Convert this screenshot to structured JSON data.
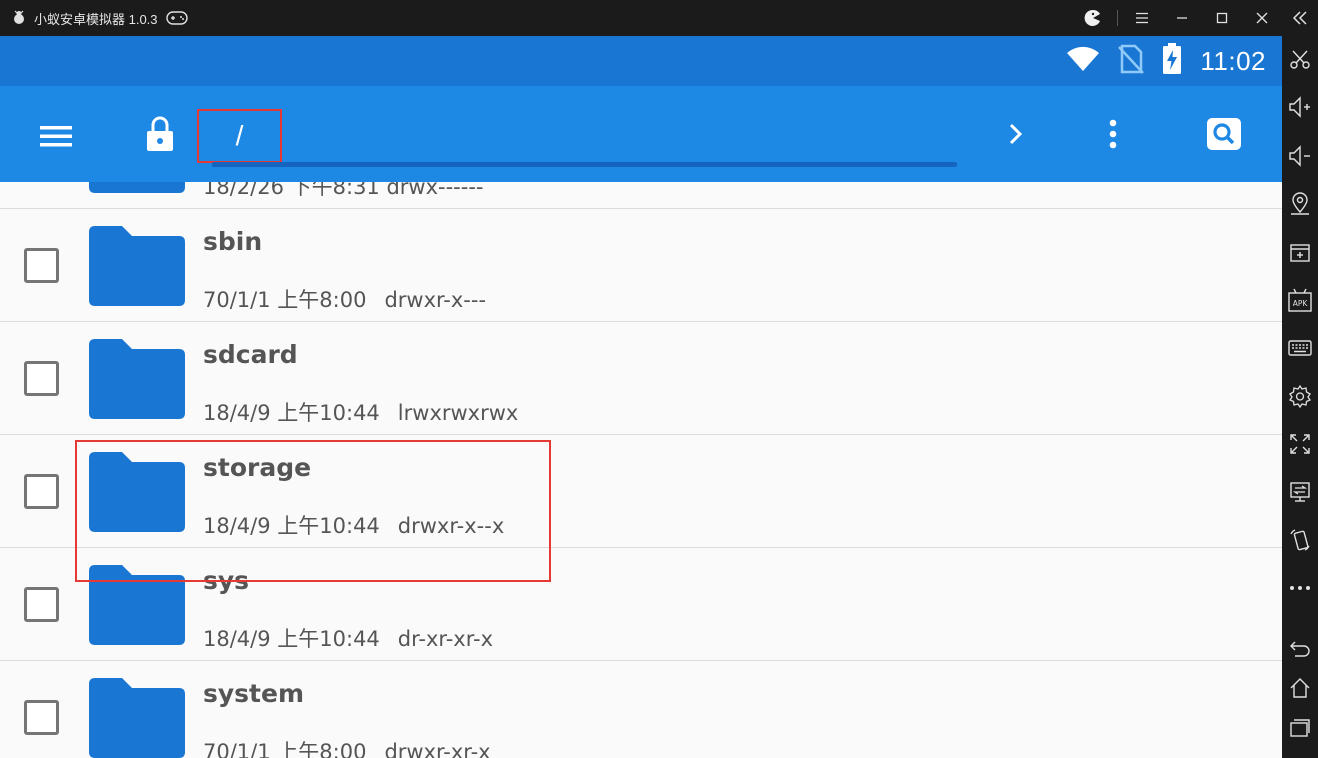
{
  "window": {
    "title": "小蚁安卓模拟器 1.0.3",
    "logo_icon": "ant-logo-icon",
    "gamepad_icon": "gamepad-icon",
    "controls": [
      "pacman-icon",
      "menu-icon",
      "minimize-icon",
      "maximize-icon",
      "close-icon"
    ]
  },
  "status_bar": {
    "time": "11:02",
    "icons": [
      "wifi-icon",
      "no-sim-icon",
      "battery-charging-icon"
    ]
  },
  "app_bar": {
    "path": "/",
    "icons": [
      "hamburger-menu-icon",
      "lock-icon",
      "chevron-right-icon",
      "more-vert-icon",
      "search-icon"
    ]
  },
  "partial_row": {
    "meta": "18/2/26 下午8:31   drwx------"
  },
  "files": [
    {
      "name": "sbin",
      "date": "70/1/1 上午8:00",
      "perm": "drwxr-x---"
    },
    {
      "name": "sdcard",
      "date": "18/4/9 上午10:44",
      "perm": "lrwxrwxrwx"
    },
    {
      "name": "storage",
      "date": "18/4/9 上午10:44",
      "perm": "drwxr-x--x"
    },
    {
      "name": "sys",
      "date": "18/4/9 上午10:44",
      "perm": "dr-xr-xr-x"
    },
    {
      "name": "system",
      "date": "70/1/1 上午8:00",
      "perm": "drwxr-xr-x"
    }
  ],
  "sidebar": {
    "icons": [
      "collapse-icon",
      "scissors-icon",
      "volume-up-icon",
      "volume-down-icon",
      "location-icon",
      "add-window-icon",
      "apk-icon",
      "keyboard-icon",
      "settings-icon",
      "fullscreen-icon",
      "screen-share-icon",
      "rotate-icon",
      "more-icon",
      "back-icon",
      "home-icon",
      "recents-icon"
    ],
    "apk_label": "APK"
  },
  "colors": {
    "status_bar": "#1976d2",
    "app_bar": "#1e88e5",
    "folder": "#1976d2",
    "highlight": "#e53935"
  }
}
